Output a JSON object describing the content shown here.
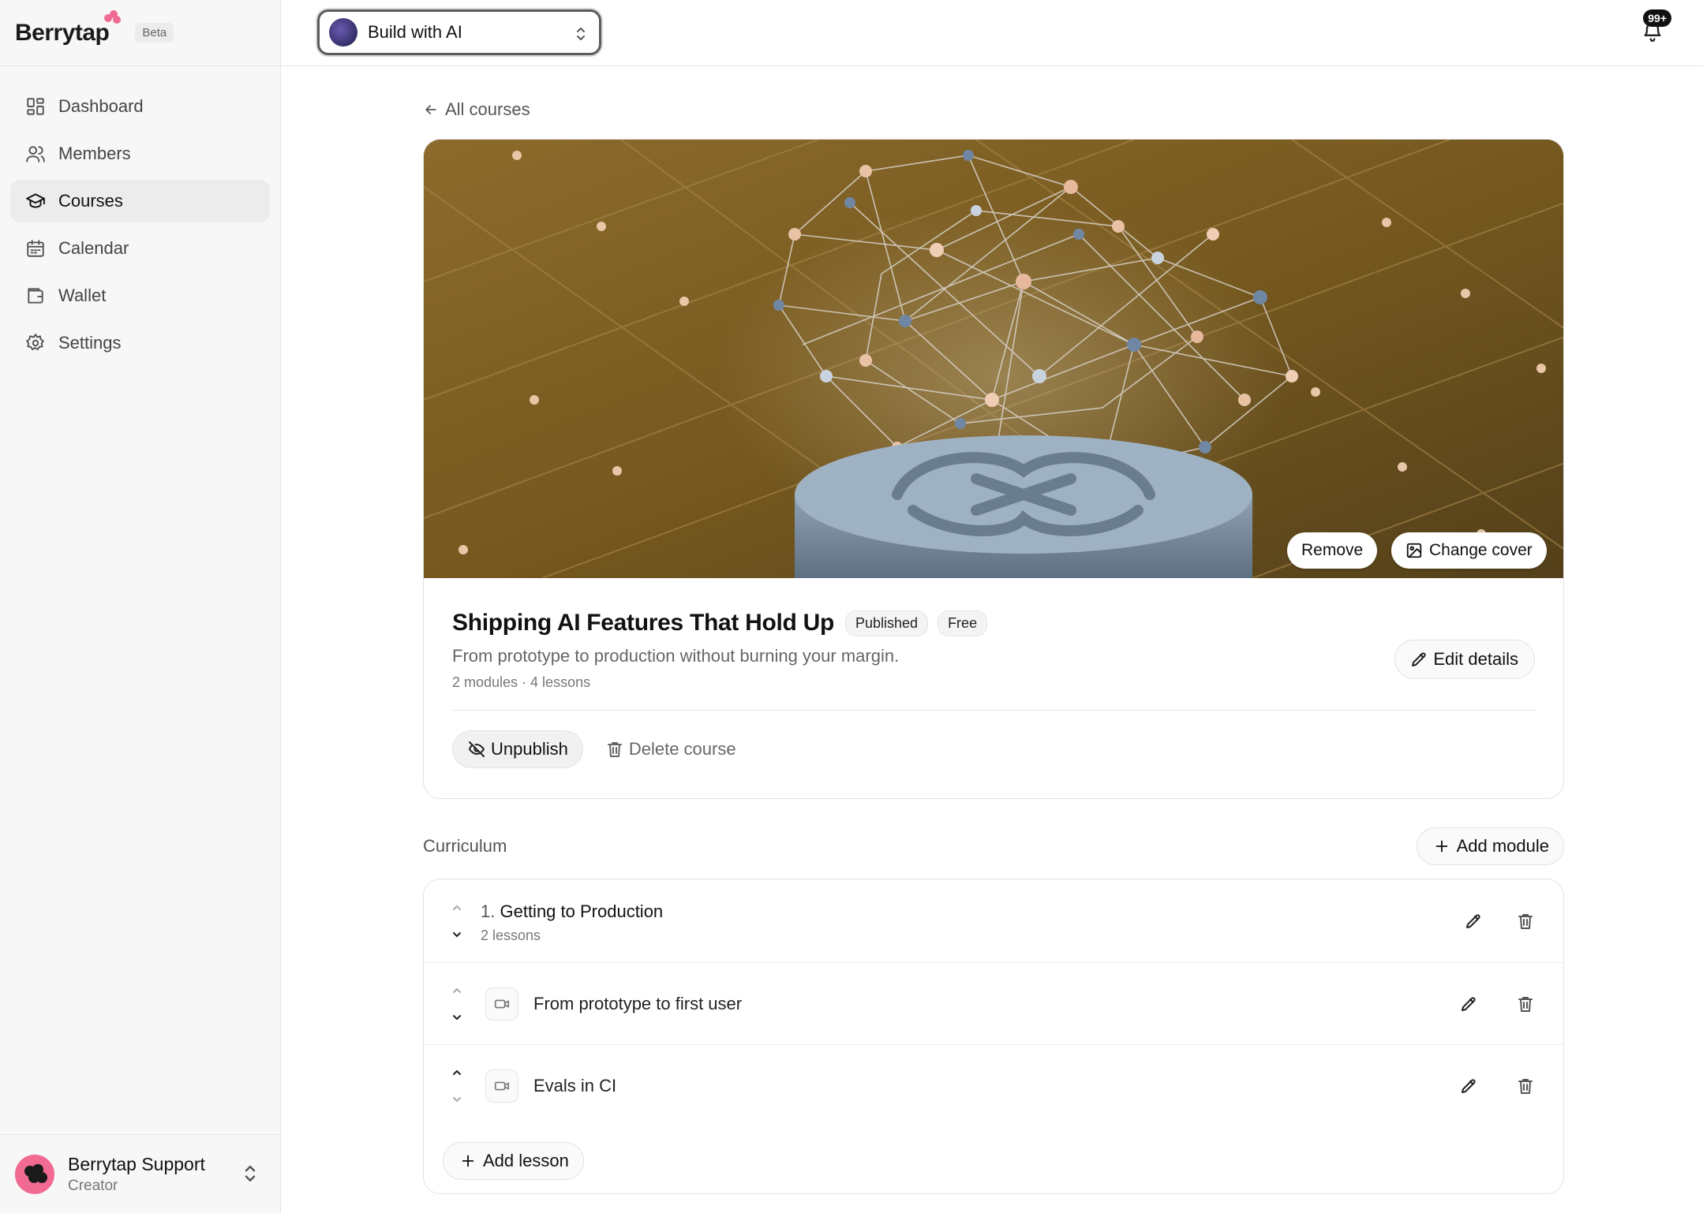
{
  "brand": {
    "name": "Berrytap",
    "tag": "Beta"
  },
  "sidebar": {
    "items": [
      {
        "label": "Dashboard",
        "icon": "dashboard-icon"
      },
      {
        "label": "Members",
        "icon": "users-icon"
      },
      {
        "label": "Courses",
        "icon": "graduation-cap-icon",
        "active": true
      },
      {
        "label": "Calendar",
        "icon": "calendar-icon"
      },
      {
        "label": "Wallet",
        "icon": "wallet-icon"
      },
      {
        "label": "Settings",
        "icon": "gear-icon"
      }
    ],
    "user": {
      "name": "Berrytap Support",
      "role": "Creator"
    }
  },
  "topbar": {
    "workspace": "Build with AI",
    "notifications_badge": "99+"
  },
  "back_link": "All courses",
  "course": {
    "title": "Shipping AI Features That Hold Up",
    "status_badge": "Published",
    "price_badge": "Free",
    "subtitle": "From prototype to production without burning your margin.",
    "meta": "2 modules · 4 lessons",
    "edit_label": "Edit details",
    "remove_cover_label": "Remove",
    "change_cover_label": "Change cover",
    "unpublish_label": "Unpublish",
    "delete_label": "Delete course"
  },
  "curriculum": {
    "heading": "Curriculum",
    "add_module_label": "Add module",
    "add_lesson_label": "Add lesson",
    "module": {
      "number": "1.",
      "title": "Getting to Production",
      "lessons_count": "2 lessons"
    },
    "lessons": [
      {
        "title": "From prototype to first user",
        "type": "video"
      },
      {
        "title": "Evals in CI",
        "type": "video"
      }
    ]
  },
  "colors": {
    "accent": "#f06a92",
    "cover_bg": "#7a5c24"
  }
}
